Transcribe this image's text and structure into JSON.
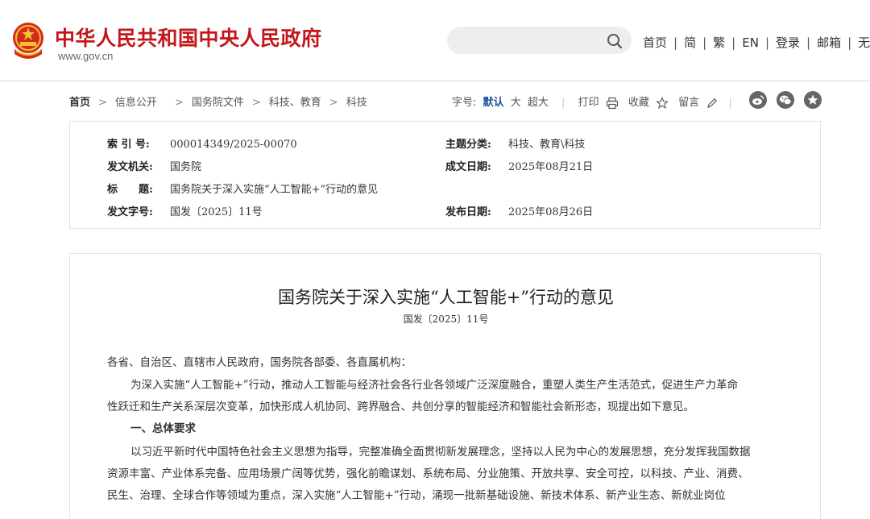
{
  "header": {
    "site_name": "中华人民共和国中央人民政府",
    "domain": "www.gov.cn",
    "search_placeholder": "",
    "nav": [
      "首页",
      "简",
      "繁",
      "EN",
      "登录",
      "邮箱",
      "无障碍"
    ]
  },
  "breadcrumb": [
    "首页",
    "信息公开",
    "国务院文件",
    "科技、教育",
    "科技"
  ],
  "tools": {
    "font_label": "字号:",
    "font_sizes": [
      "默认",
      "大",
      "超大"
    ],
    "print": "打印",
    "favorite": "收藏",
    "comment": "留言"
  },
  "info": {
    "index_label": "索 引 号:",
    "index_value": "000014349/2025-00070",
    "topic_label": "主题分类:",
    "topic_value": "科技、教育\\科技",
    "issuer_label": "发文机关:",
    "issuer_value": "国务院",
    "date_label": "成文日期:",
    "date_value": "2025年08月21日",
    "title_label": "标　　题:",
    "title_value": "国务院关于深入实施“人工智能+”行动的意见",
    "docno_label": "发文字号:",
    "docno_value": "国发〔2025〕11号",
    "publish_label": "发布日期:",
    "publish_value": "2025年08月26日"
  },
  "article": {
    "title": "国务院关于深入实施“人工智能+”行动的意见",
    "docno": "国发〔2025〕11号",
    "salutation": "各省、自治区、直辖市人民政府，国务院各部委、各直属机构：",
    "p1_line1": "为深入实施“人工智能+”行动，推动人工智能与经济社会各行业各领域广泛深度融合，重塑人类生产生活范式，促进生产力革命",
    "p1_line2": "性跃迁和生产关系深层次变革，加快形成人机协同、跨界融合、共创分享的智能经济和智能社会新形态，现提出如下意见。",
    "heading1": "一、总体要求",
    "p2_line1": "以习近平新时代中国特色社会主义思想为指导，完整准确全面贯彻新发展理念，坚持以人民为中心的发展思想，充分发挥我国数据",
    "p2_line2": "资源丰富、产业体系完备、应用场景广阔等优势，强化前瞻谋划、系统布局、分业施策、开放共享、安全可控，以科技、产业、消费、",
    "p2_line3": "民生、治理、全球合作等领域为重点，深入实施“人工智能+”行动，涌现一批新基础设施、新技术体系、新产业生态、新就业岗位"
  },
  "colors": {
    "brand_red": "#c3171b",
    "active_blue": "#1e56a0"
  }
}
